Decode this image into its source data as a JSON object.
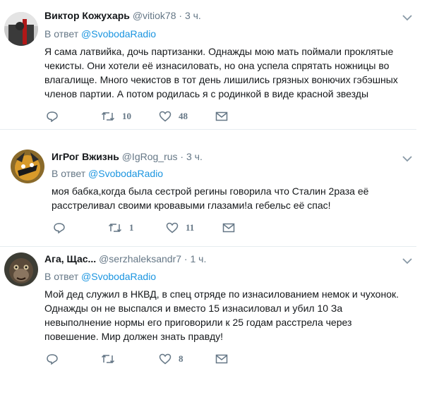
{
  "reply_prefix": "В ответ",
  "tweets": [
    {
      "name": "Виктор Кожухарь",
      "handle": "@vitiok78",
      "time": "3 ч.",
      "reply_to": "@SvobodaRadio",
      "lines": [
        "Я сама латвийка, дочь партизанки. Однажды мою мать поймали проклятые",
        "чекисты. Они хотели её изнасиловать, но она успела спрятать ножницы во",
        "влагалище. Много чекистов в тот день лишились грязных вонючих гэбэшных",
        "членов партии. А потом родилась я с родинкой в виде красной звезды"
      ],
      "retweets": "10",
      "likes": "48"
    },
    {
      "name": "ИгРог Вжизнь",
      "handle": "@IgRog_rus",
      "time": "3 ч.",
      "reply_to": "@SvobodaRadio",
      "lines": [
        "моя бабка,когда была сестрой регины говорила что Сталин 2раза её",
        "расстреливал своими кровавыми глазами!а гебельс её спас!"
      ],
      "retweets": "1",
      "likes": "11"
    },
    {
      "name": "Ага, Щас...",
      "handle": "@serzhaleksandr7",
      "time": "1 ч.",
      "reply_to": "@SvobodaRadio",
      "lines": [
        "Мой дед служил в НКВД, в спец отряде по изнасилованием немок и чухонок.",
        "Однажды он не выспался и вместо 15 изнасиловал и убил 10  За",
        "невыполнение нормы его приговорили к 25 годам расстрела через",
        "повешение. Мир должен знать правду!"
      ],
      "retweets": "",
      "likes": "8"
    }
  ]
}
